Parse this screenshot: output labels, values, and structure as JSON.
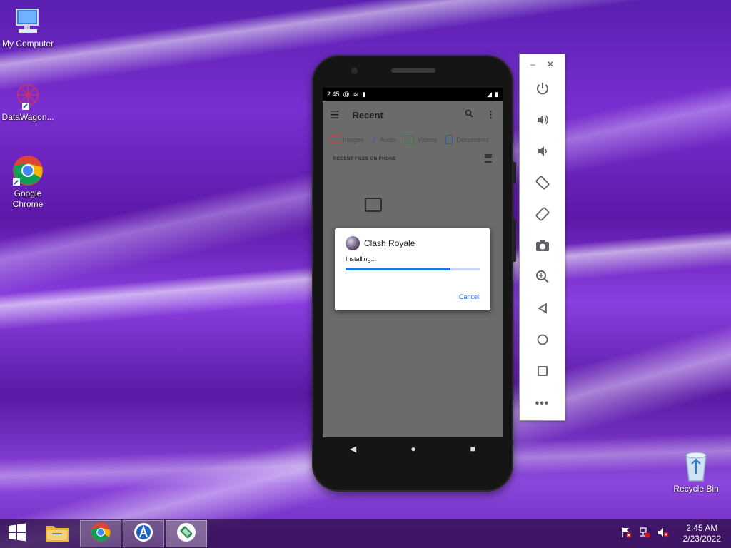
{
  "desktop": {
    "icons": [
      {
        "label": "My Computer"
      },
      {
        "label": "DataWagon..."
      },
      {
        "label": "Google Chrome"
      },
      {
        "label": "Recycle Bin"
      }
    ]
  },
  "phone": {
    "status_bar": {
      "time": "2:45"
    },
    "app_bar": {
      "title": "Recent"
    },
    "chips": [
      "Images",
      "Audio",
      "Videos",
      "Documents"
    ],
    "chip_colors": [
      "#c0453a",
      "#5b3cc4",
      "#2e7d32",
      "#1565c0"
    ],
    "section_header": "RECENT FILES ON PHONE"
  },
  "dialog": {
    "app_name": "Clash Royale",
    "status": "Installing...",
    "progress_fraction": 0.78,
    "cancel_label": "Cancel"
  },
  "toolbar": {
    "items": [
      "power-icon",
      "volume-up-icon",
      "volume-down-icon",
      "rotate-left-icon",
      "rotate-right-icon",
      "camera-icon",
      "zoom-icon",
      "back-icon",
      "home-icon",
      "overview-icon",
      "more-icon"
    ]
  },
  "taskbar": {
    "clock_time": "2:45 AM",
    "clock_date": "2/23/2022"
  }
}
